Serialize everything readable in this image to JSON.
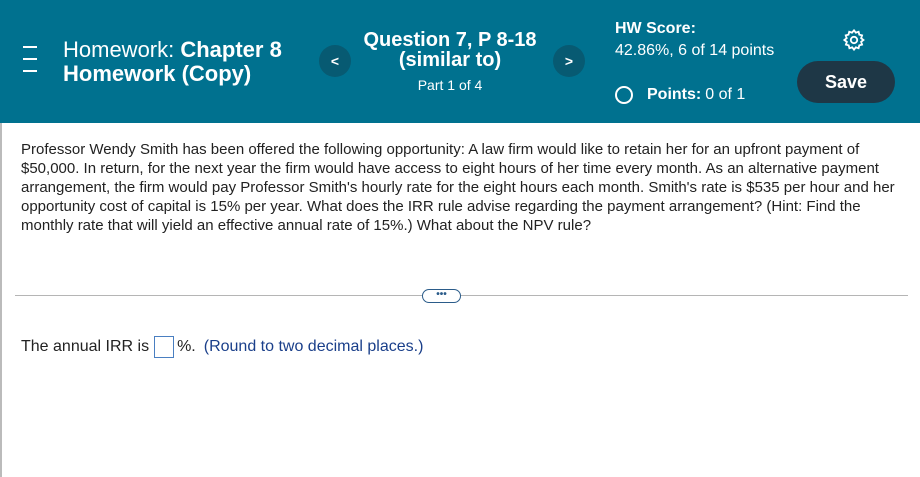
{
  "header": {
    "title_plain": "Homework: ",
    "title_bold_1": "Chapter 8",
    "title_bold_2": "Homework (Copy)",
    "prev_label": "<",
    "next_label": ">",
    "question_title": "Question 7, P 8-18 (similar to)",
    "question_part": "Part 1 of 4",
    "score_label": "HW Score:",
    "score_value": "42.86%, 6 of 14 points",
    "points_label": "Points:",
    "points_value": "0 of 1",
    "save_label": "Save"
  },
  "question": {
    "text": "Professor Wendy Smith has been offered the following opportunity: A law firm would like to retain her for an upfront payment of $50,000. In return, for the next year the firm would have access to eight hours of her time every month. As an alternative  payment arrangement, the firm would pay Professor Smith's hourly rate for the eight hours each month. Smith's rate is $535 per hour and her opportunity cost of capital is 15% per year. What does the IRR rule advise regarding the payment arrangement? (Hint: Find the monthly rate that will yield an effective annual rate of 15%.) What about the NPV rule?"
  },
  "more_button": "•••",
  "answer": {
    "prefix": "The annual IRR is",
    "input_value": "",
    "unit": "%.",
    "hint": "(Round to two decimal places.)"
  },
  "colors": {
    "header_bg": "#00718f",
    "save_bg": "#1e3746",
    "hint_text": "#1a3f8a"
  }
}
